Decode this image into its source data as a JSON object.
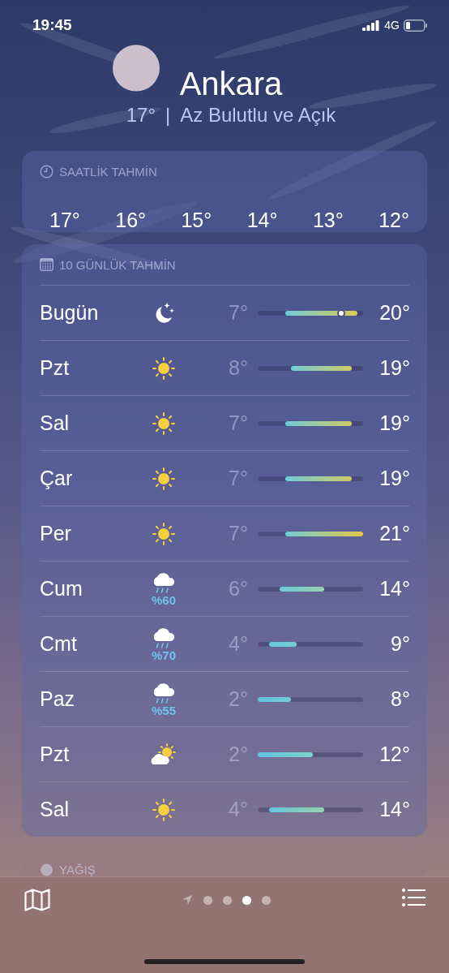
{
  "status_bar": {
    "time": "19:45",
    "network": "4G"
  },
  "location": {
    "city": "Ankara",
    "temperature": "17°",
    "separator": "|",
    "condition": "Az Bulutlu ve Açık"
  },
  "hourly": {
    "title": "SAATLİK TAHMİN",
    "temperatures": [
      "17°",
      "16°",
      "15°",
      "14°",
      "13°",
      "12°"
    ]
  },
  "daily": {
    "title": "10 GÜNLÜK TAHMİN",
    "days": [
      {
        "day": "Bugün",
        "kind": "moon-stars",
        "low": "7°",
        "high": "20°",
        "current": true
      },
      {
        "day": "Pzt",
        "kind": "sun",
        "low": "8°",
        "high": "19°",
        "current": false
      },
      {
        "day": "Sal",
        "kind": "sun",
        "low": "7°",
        "high": "19°",
        "current": false
      },
      {
        "day": "Çar",
        "kind": "sun",
        "low": "7°",
        "high": "19°",
        "current": false
      },
      {
        "day": "Per",
        "kind": "sun",
        "low": "7°",
        "high": "21°",
        "current": false
      },
      {
        "day": "Cum",
        "kind": "rain",
        "precipitation": "%60",
        "low": "6°",
        "high": "14°",
        "current": false
      },
      {
        "day": "Cmt",
        "kind": "rain",
        "precipitation": "%70",
        "low": "4°",
        "high": "9°",
        "current": false
      },
      {
        "day": "Paz",
        "kind": "rain",
        "precipitation": "%55",
        "low": "2°",
        "high": "8°",
        "current": false
      },
      {
        "day": "Pzt",
        "kind": "partly-sunny",
        "low": "2°",
        "high": "12°",
        "current": false
      },
      {
        "day": "Sal",
        "kind": "sun",
        "low": "4°",
        "high": "14°",
        "current": false
      }
    ]
  },
  "next_card": {
    "title": "YAĞIŞ"
  },
  "page_indicator": [
    {
      "kind": "location",
      "selected": false
    },
    {
      "kind": "dot",
      "selected": false
    },
    {
      "kind": "dot",
      "selected": false
    },
    {
      "kind": "dot",
      "selected": true
    },
    {
      "kind": "dot",
      "selected": false
    }
  ]
}
